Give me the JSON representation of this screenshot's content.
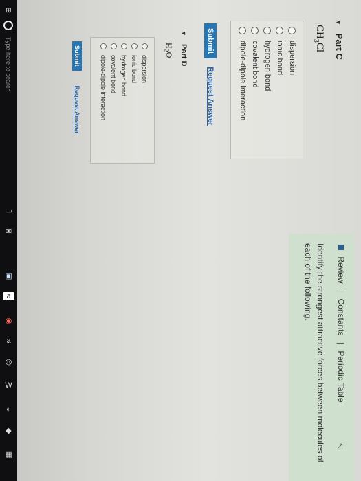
{
  "part_c": {
    "heading": "Part C",
    "formula_main": "CH",
    "formula_sub": "3",
    "formula_tail": "Cl",
    "options": [
      "dispersion",
      "ionic bond",
      "hydrogen bond",
      "covalent bond",
      "dipole-dipole interaction"
    ],
    "submit_label": "Submit",
    "request_label": "Request Answer"
  },
  "info": {
    "review": "Review",
    "constants": "Constants",
    "periodic_table": "Periodic Table",
    "separator": "|",
    "instruction": "Identify the strongest attractive forces between molecules of each of the following."
  },
  "part_d": {
    "heading": "Part D",
    "formula_main": "H",
    "formula_sub": "2",
    "formula_tail": "O",
    "options": [
      "dispersion",
      "ionic bond",
      "hydrogen bond",
      "covalent bond",
      "dipole-dipole interaction"
    ],
    "submit_label": "Submit",
    "request_label": "Request Answer"
  },
  "taskbar": {
    "search_placeholder": "Type here to search"
  },
  "colors": {
    "accent": "#2776b2",
    "info_panel": "#cfe0cf",
    "taskbar": "#0f0f11"
  }
}
